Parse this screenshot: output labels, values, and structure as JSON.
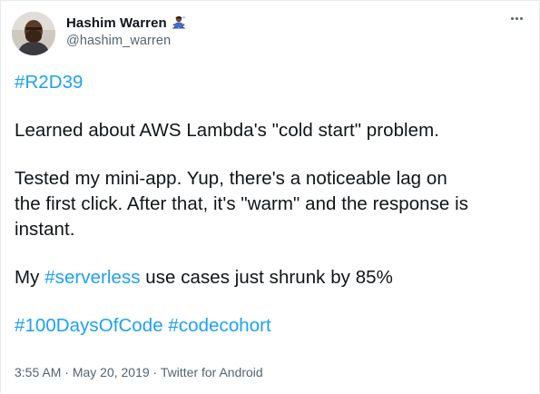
{
  "author": {
    "display_name": "Hashim Warren",
    "handle": "@hashim_warren",
    "avatar_icon": "profile-photo",
    "name_emoji_icon": "person-in-lotus-position-emoji"
  },
  "menu": {
    "more_icon": "more-horizontal-icon"
  },
  "tweet": {
    "hashtag_r2d39": "#R2D39",
    "para2": "Learned about AWS Lambda's \"cold start\" problem.",
    "para3_line1": "Tested my mini-app. Yup, there's a noticeable lag on",
    "para3_line2": "the first click. After that, it's \"warm\" and the response is",
    "para3_line3": "instant.",
    "para4_prefix": "My ",
    "hashtag_serverless": "#serverless",
    "para4_suffix": " use cases just shrunk by 85%",
    "hashtag_100days": "#100DaysOfCode",
    "hashtag_codecohort": "#codecohort",
    "hashtag_separator": " "
  },
  "meta": {
    "time": "3:55 AM",
    "separator1": " · ",
    "date": "May 20, 2019",
    "separator2": " · ",
    "source": "Twitter for Android"
  },
  "colors": {
    "link": "#1da1f2",
    "text": "#0f1419",
    "secondary": "#536471",
    "border": "#e6ecf0"
  }
}
